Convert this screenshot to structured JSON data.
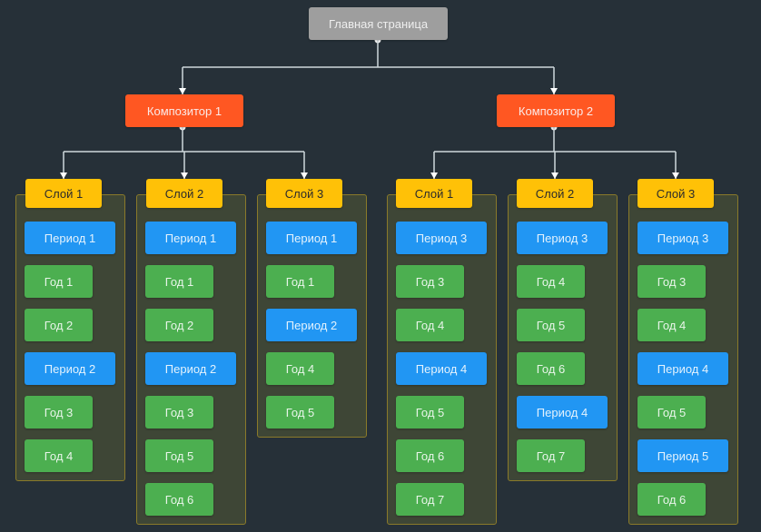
{
  "diagram": {
    "root": {
      "label": "Главная страница"
    },
    "composers": [
      {
        "label": "Композитор 1",
        "layers": [
          {
            "label": "Слой 1",
            "items": [
              {
                "type": "period",
                "label": "Период 1"
              },
              {
                "type": "year",
                "label": "Год 1"
              },
              {
                "type": "year",
                "label": "Год 2"
              },
              {
                "type": "period",
                "label": "Период 2"
              },
              {
                "type": "year",
                "label": "Год 3"
              },
              {
                "type": "year",
                "label": "Год 4"
              }
            ]
          },
          {
            "label": "Слой 2",
            "items": [
              {
                "type": "period",
                "label": "Период 1"
              },
              {
                "type": "year",
                "label": "Год 1"
              },
              {
                "type": "year",
                "label": "Год 2"
              },
              {
                "type": "period",
                "label": "Период 2"
              },
              {
                "type": "year",
                "label": "Год 3"
              },
              {
                "type": "year",
                "label": "Год 5"
              },
              {
                "type": "year",
                "label": "Год 6"
              }
            ]
          },
          {
            "label": "Слой 3",
            "items": [
              {
                "type": "period",
                "label": "Период 1"
              },
              {
                "type": "year",
                "label": "Год 1"
              },
              {
                "type": "period",
                "label": "Период 2"
              },
              {
                "type": "year",
                "label": "Год 4"
              },
              {
                "type": "year",
                "label": "Год 5"
              }
            ]
          }
        ]
      },
      {
        "label": "Композитор 2",
        "layers": [
          {
            "label": "Слой 1",
            "items": [
              {
                "type": "period",
                "label": "Период 3"
              },
              {
                "type": "year",
                "label": "Год 3"
              },
              {
                "type": "year",
                "label": "Год 4"
              },
              {
                "type": "period",
                "label": "Период 4"
              },
              {
                "type": "year",
                "label": "Год 5"
              },
              {
                "type": "year",
                "label": "Год 6"
              },
              {
                "type": "year",
                "label": "Год 7"
              }
            ]
          },
          {
            "label": "Слой 2",
            "items": [
              {
                "type": "period",
                "label": "Период 3"
              },
              {
                "type": "year",
                "label": "Год 4"
              },
              {
                "type": "year",
                "label": "Год 5"
              },
              {
                "type": "year",
                "label": "Год 6"
              },
              {
                "type": "period",
                "label": "Период 4"
              },
              {
                "type": "year",
                "label": "Год 7"
              }
            ]
          },
          {
            "label": "Слой 3",
            "items": [
              {
                "type": "period",
                "label": "Период 3"
              },
              {
                "type": "year",
                "label": "Год 3"
              },
              {
                "type": "year",
                "label": "Год 4"
              },
              {
                "type": "period",
                "label": "Период 4"
              },
              {
                "type": "year",
                "label": "Год 5"
              },
              {
                "type": "period",
                "label": "Период 5"
              },
              {
                "type": "year",
                "label": "Год 6"
              }
            ]
          }
        ]
      }
    ]
  },
  "colors": {
    "background": "#263038",
    "root": "#9e9e9e",
    "composer": "#ff5722",
    "layer": "#ffc107",
    "period": "#2196f3",
    "year": "#4caf50",
    "connector": "#cfd8dc"
  }
}
